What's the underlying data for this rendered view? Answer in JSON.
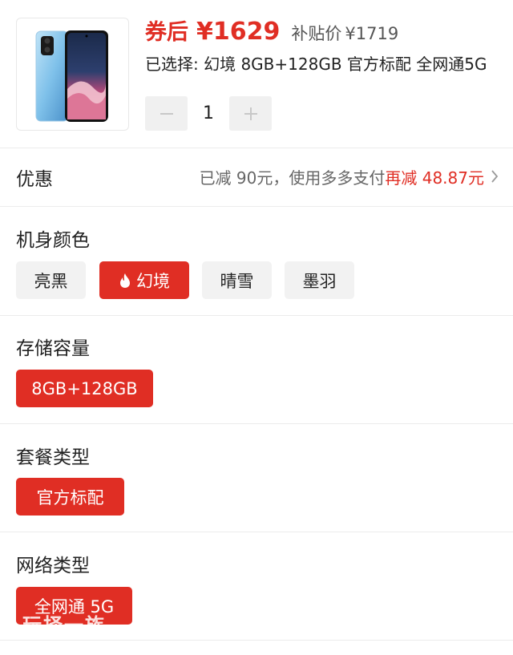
{
  "product": {
    "image_icon": "phone-image",
    "coupon_label": "券后",
    "coupon_price": "¥1629",
    "subsidy_label": "补贴价",
    "subsidy_price": "¥1719",
    "selected_text": "已选择: 幻境 8GB+128GB 官方标配 全网通5G",
    "quantity": "1",
    "minus_icon": "minus-icon",
    "plus_icon": "plus-icon"
  },
  "discount": {
    "title": "优惠",
    "detail_gray": "已减 90元，使用多多支付",
    "detail_red": "再减 48.87元",
    "chevron_icon": "chevron-right-icon"
  },
  "color_section": {
    "title": "机身颜色",
    "options": [
      {
        "label": "亮黑",
        "selected": false
      },
      {
        "label": "幻境",
        "selected": true,
        "icon": "flame-icon"
      },
      {
        "label": "晴雪",
        "selected": false
      },
      {
        "label": "墨羽",
        "selected": false
      }
    ]
  },
  "storage_section": {
    "title": "存储容量",
    "options": [
      {
        "label": "8GB+128GB",
        "selected": true
      }
    ]
  },
  "bundle_section": {
    "title": "套餐类型",
    "options": [
      {
        "label": "官方标配",
        "selected": true
      }
    ]
  },
  "network_section": {
    "title": "网络类型",
    "options": [
      {
        "label": "全网通 5G",
        "selected": true
      }
    ]
  },
  "watermark": "玩择一族",
  "colors": {
    "accent": "#e02e24",
    "chip_bg": "#f2f2f2",
    "divider": "#ececec"
  }
}
